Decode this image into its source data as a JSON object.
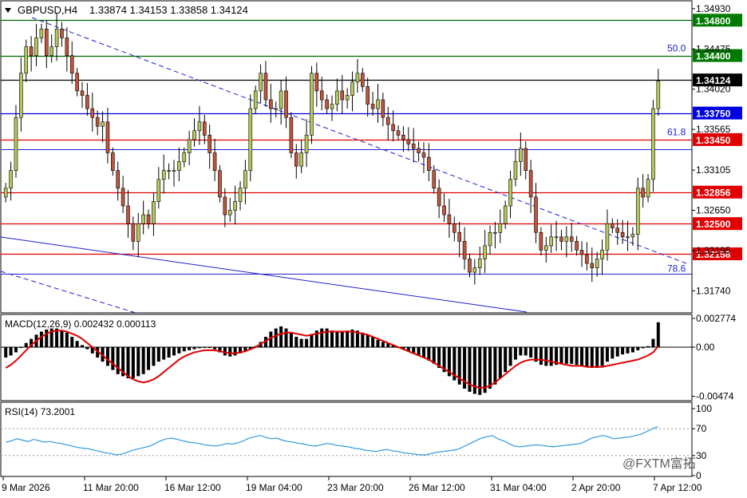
{
  "header": {
    "symbol": "GBPUSD,H4",
    "ohlc": "1.33874 1.34153 1.33858 1.34124"
  },
  "price_axis": {
    "ticks": [
      "1.34930",
      "1.34475",
      "1.34020",
      "1.33565",
      "1.33105",
      "1.32650",
      "1.32195",
      "1.31740"
    ],
    "min": 1.315,
    "max": 1.3501
  },
  "level_badges": [
    {
      "label": "1.34800",
      "value": 1.348,
      "color": "#007a00"
    },
    {
      "label": "1.34400",
      "value": 1.344,
      "color": "#007a00"
    },
    {
      "label": "1.34124",
      "value": 1.34124,
      "color": "#000000"
    },
    {
      "label": "1.33750",
      "value": 1.3375,
      "color": "#0000e0"
    },
    {
      "label": "1.33450",
      "value": 1.3345,
      "color": "#e00000"
    },
    {
      "label": "1.32856",
      "value": 1.32856,
      "color": "#e00000"
    },
    {
      "label": "1.32500",
      "value": 1.325,
      "color": "#e00000"
    },
    {
      "label": "1.32158",
      "value": 1.32158,
      "color": "#e00000"
    }
  ],
  "fib_labels": [
    {
      "label": "50.0",
      "value": 1.3442
    },
    {
      "label": "61.8",
      "value": 1.3347
    },
    {
      "label": "78.6",
      "value": 1.3193
    }
  ],
  "macd": {
    "title": "MACD(12,26,9) 0.002432 0.000113",
    "ticks": [
      "0.002774",
      "0.00",
      "-0.00474"
    ],
    "min": -0.005,
    "max": 0.003
  },
  "rsi": {
    "title": "RSI(14) 73.2001",
    "ticks": [
      "100",
      "70",
      "30",
      "0"
    ],
    "levels": [
      70,
      30
    ]
  },
  "time_labels": [
    "9 Mar 2026",
    "11 Mar 20:00",
    "16 Mar 12:00",
    "19 Mar 04:00",
    "23 Mar 20:00",
    "26 Mar 12:00",
    "31 Mar 04:00",
    "2 Apr 20:00",
    "7 Apr 12:00"
  ],
  "watermark": "@FXTM富拓",
  "colors": {
    "bull": "#b3c95a",
    "bear": "#c0563c",
    "macd_hist": "#000000",
    "macd_signal": "#e00000",
    "rsi": "#3399dd",
    "fib": "#1f1fd0",
    "support_green": "#006400",
    "resistance_red": "#e00000"
  },
  "chart_data": [
    {
      "type": "candlestick",
      "title": "GBPUSD,H4",
      "ylim": [
        1.315,
        1.3501
      ],
      "x_labels": [
        "9 Mar 2026",
        "11 Mar 20:00",
        "16 Mar 12:00",
        "19 Mar 04:00",
        "23 Mar 20:00",
        "26 Mar 12:00",
        "31 Mar 04:00",
        "2 Apr 20:00",
        "7 Apr 12:00"
      ],
      "close": [
        1.329,
        1.331,
        1.337,
        1.342,
        1.345,
        1.344,
        1.346,
        1.347,
        1.344,
        1.345,
        1.347,
        1.346,
        1.344,
        1.342,
        1.34,
        1.3395,
        1.338,
        1.337,
        1.336,
        1.3365,
        1.333,
        1.331,
        1.329,
        1.327,
        1.325,
        1.323,
        1.325,
        1.326,
        1.325,
        1.3275,
        1.33,
        1.331,
        1.331,
        1.331,
        1.332,
        1.333,
        1.3345,
        1.3355,
        1.3365,
        1.335,
        1.333,
        1.331,
        1.328,
        1.326,
        1.3265,
        1.3275,
        1.329,
        1.331,
        1.338,
        1.34,
        1.342,
        1.339,
        1.338,
        1.338,
        1.34,
        1.337,
        1.333,
        1.3315,
        1.333,
        1.335,
        1.342,
        1.34,
        1.339,
        1.338,
        1.3385,
        1.34,
        1.339,
        1.3395,
        1.341,
        1.342,
        1.3405,
        1.3385,
        1.338,
        1.339,
        1.337,
        1.3362,
        1.3355,
        1.335,
        1.3345,
        1.334,
        1.3335,
        1.333,
        1.3325,
        1.331,
        1.329,
        1.327,
        1.326,
        1.325,
        1.324,
        1.323,
        1.321,
        1.3195,
        1.32,
        1.321,
        1.3225,
        1.324,
        1.324,
        1.325,
        1.327,
        1.33,
        1.332,
        1.3335,
        1.331,
        1.328,
        1.324,
        1.322,
        1.3225,
        1.3235,
        1.3235,
        1.323,
        1.3235,
        1.323,
        1.322,
        1.3215,
        1.3205,
        1.32,
        1.321,
        1.322,
        1.325,
        1.3245,
        1.324,
        1.3235,
        1.3235,
        1.3238,
        1.329,
        1.328,
        1.33,
        1.338,
        1.3411
      ],
      "macd_histogram": [
        -0.001,
        -0.0008,
        -0.0005,
        0.0,
        0.0004,
        0.0008,
        0.0012,
        0.0015,
        0.0017,
        0.0018,
        0.0018,
        0.0016,
        0.0014,
        0.001,
        0.0006,
        0.0002,
        -0.0002,
        -0.0006,
        -0.001,
        -0.0014,
        -0.0018,
        -0.0022,
        -0.0026,
        -0.0028,
        -0.003,
        -0.003,
        -0.0028,
        -0.0026,
        -0.0022,
        -0.0018,
        -0.0014,
        -0.0012,
        -0.001,
        -0.0008,
        -0.0006,
        -0.0004,
        -0.0003,
        -0.0002,
        -0.0001,
        0.0,
        0.0,
        -0.0002,
        -0.0005,
        -0.0008,
        -0.0009,
        -0.0008,
        -0.0006,
        -0.0004,
        -0.0002,
        0.0001,
        0.0005,
        0.001,
        0.0015,
        0.0018,
        0.002,
        0.0018,
        0.0014,
        0.001,
        0.0008,
        0.0008,
        0.0012,
        0.0016,
        0.0018,
        0.0018,
        0.0016,
        0.0015,
        0.0015,
        0.0016,
        0.0017,
        0.0016,
        0.0014,
        0.0012,
        0.001,
        0.0007,
        0.0005,
        0.0004,
        0.0002,
        0.0,
        -0.0002,
        -0.0004,
        -0.0006,
        -0.0008,
        -0.001,
        -0.0013,
        -0.0016,
        -0.002,
        -0.0024,
        -0.0028,
        -0.0032,
        -0.0036,
        -0.004,
        -0.0043,
        -0.0045,
        -0.0046,
        -0.0044,
        -0.004,
        -0.0036,
        -0.003,
        -0.0024,
        -0.0018,
        -0.0012,
        -0.0008,
        -0.0008,
        -0.001,
        -0.0014,
        -0.0017,
        -0.0018,
        -0.0018,
        -0.0017,
        -0.0016,
        -0.0016,
        -0.0016,
        -0.0017,
        -0.0018,
        -0.0019,
        -0.002,
        -0.002,
        -0.0018,
        -0.0014,
        -0.0011,
        -0.0009,
        -0.0007,
        -0.0006,
        -0.0005,
        -0.0003,
        -0.0001,
        0.0001,
        0.0008,
        0.0024
      ],
      "macd_signal": [
        -0.002,
        -0.0017,
        -0.0013,
        -0.0008,
        -0.0003,
        0.0002,
        0.0006,
        0.001,
        0.0013,
        0.0015,
        0.0016,
        0.0016,
        0.0015,
        0.0013,
        0.0011,
        0.0008,
        0.0004,
        0.0,
        -0.0004,
        -0.0008,
        -0.0012,
        -0.0016,
        -0.002,
        -0.0024,
        -0.0028,
        -0.0031,
        -0.0033,
        -0.0034,
        -0.0033,
        -0.0031,
        -0.0028,
        -0.0024,
        -0.002,
        -0.0016,
        -0.0012,
        -0.0009,
        -0.0007,
        -0.0005,
        -0.0004,
        -0.0003,
        -0.0003,
        -0.0003,
        -0.0004,
        -0.0005,
        -0.0006,
        -0.0006,
        -0.0005,
        -0.0004,
        -0.0002,
        0.0,
        0.0003,
        0.0006,
        0.0009,
        0.0011,
        0.0013,
        0.0014,
        0.0014,
        0.0013,
        0.0012,
        0.0011,
        0.0012,
        0.0013,
        0.0014,
        0.0015,
        0.0015,
        0.0015,
        0.0015,
        0.0015,
        0.0015,
        0.0014,
        0.0013,
        0.0012,
        0.001,
        0.0008,
        0.0006,
        0.0004,
        0.0002,
        0.0,
        -0.0002,
        -0.0004,
        -0.0006,
        -0.0008,
        -0.001,
        -0.0012,
        -0.0015,
        -0.0018,
        -0.0021,
        -0.0024,
        -0.0027,
        -0.003,
        -0.0033,
        -0.0036,
        -0.0038,
        -0.0039,
        -0.0039,
        -0.0037,
        -0.0034,
        -0.003,
        -0.0026,
        -0.0022,
        -0.0018,
        -0.0015,
        -0.0013,
        -0.0012,
        -0.0012,
        -0.0012,
        -0.0013,
        -0.0014,
        -0.0015,
        -0.0016,
        -0.0017,
        -0.0018,
        -0.0018,
        -0.0018,
        -0.0019,
        -0.0019,
        -0.0019,
        -0.0019,
        -0.0018,
        -0.0017,
        -0.0016,
        -0.0015,
        -0.0014,
        -0.0013,
        -0.0012,
        -0.001,
        -0.0008,
        -0.0005,
        0.0001
      ],
      "rsi": [
        50,
        52,
        55,
        53,
        51,
        54,
        52,
        50,
        51,
        49,
        48,
        46,
        44,
        42,
        41,
        40,
        38,
        36,
        34,
        33,
        31,
        32,
        35,
        38,
        40,
        42,
        44,
        48,
        52,
        55,
        56,
        54,
        52,
        50,
        49,
        48,
        46,
        45,
        44,
        46,
        48,
        47,
        49,
        52,
        56,
        58,
        60,
        57,
        55,
        56,
        53,
        51,
        50,
        48,
        47,
        45,
        44,
        46,
        48,
        47,
        45,
        44,
        43,
        41,
        40,
        38,
        37,
        36,
        38,
        39,
        37,
        36,
        34,
        33,
        32,
        31,
        31,
        33,
        35,
        36,
        37,
        38,
        40,
        44,
        48,
        52,
        56,
        58,
        60,
        55,
        52,
        48,
        44,
        43,
        44,
        45,
        46,
        45,
        44,
        43,
        44,
        45,
        46,
        47,
        48,
        52,
        56,
        58,
        60,
        58,
        55,
        56,
        57,
        58,
        60,
        62,
        66,
        70,
        73
      ],
      "rsi_levels": [
        70,
        30
      ],
      "macd_range": [
        -0.005,
        0.003
      ],
      "rsi_range": [
        0,
        100
      ]
    }
  ]
}
